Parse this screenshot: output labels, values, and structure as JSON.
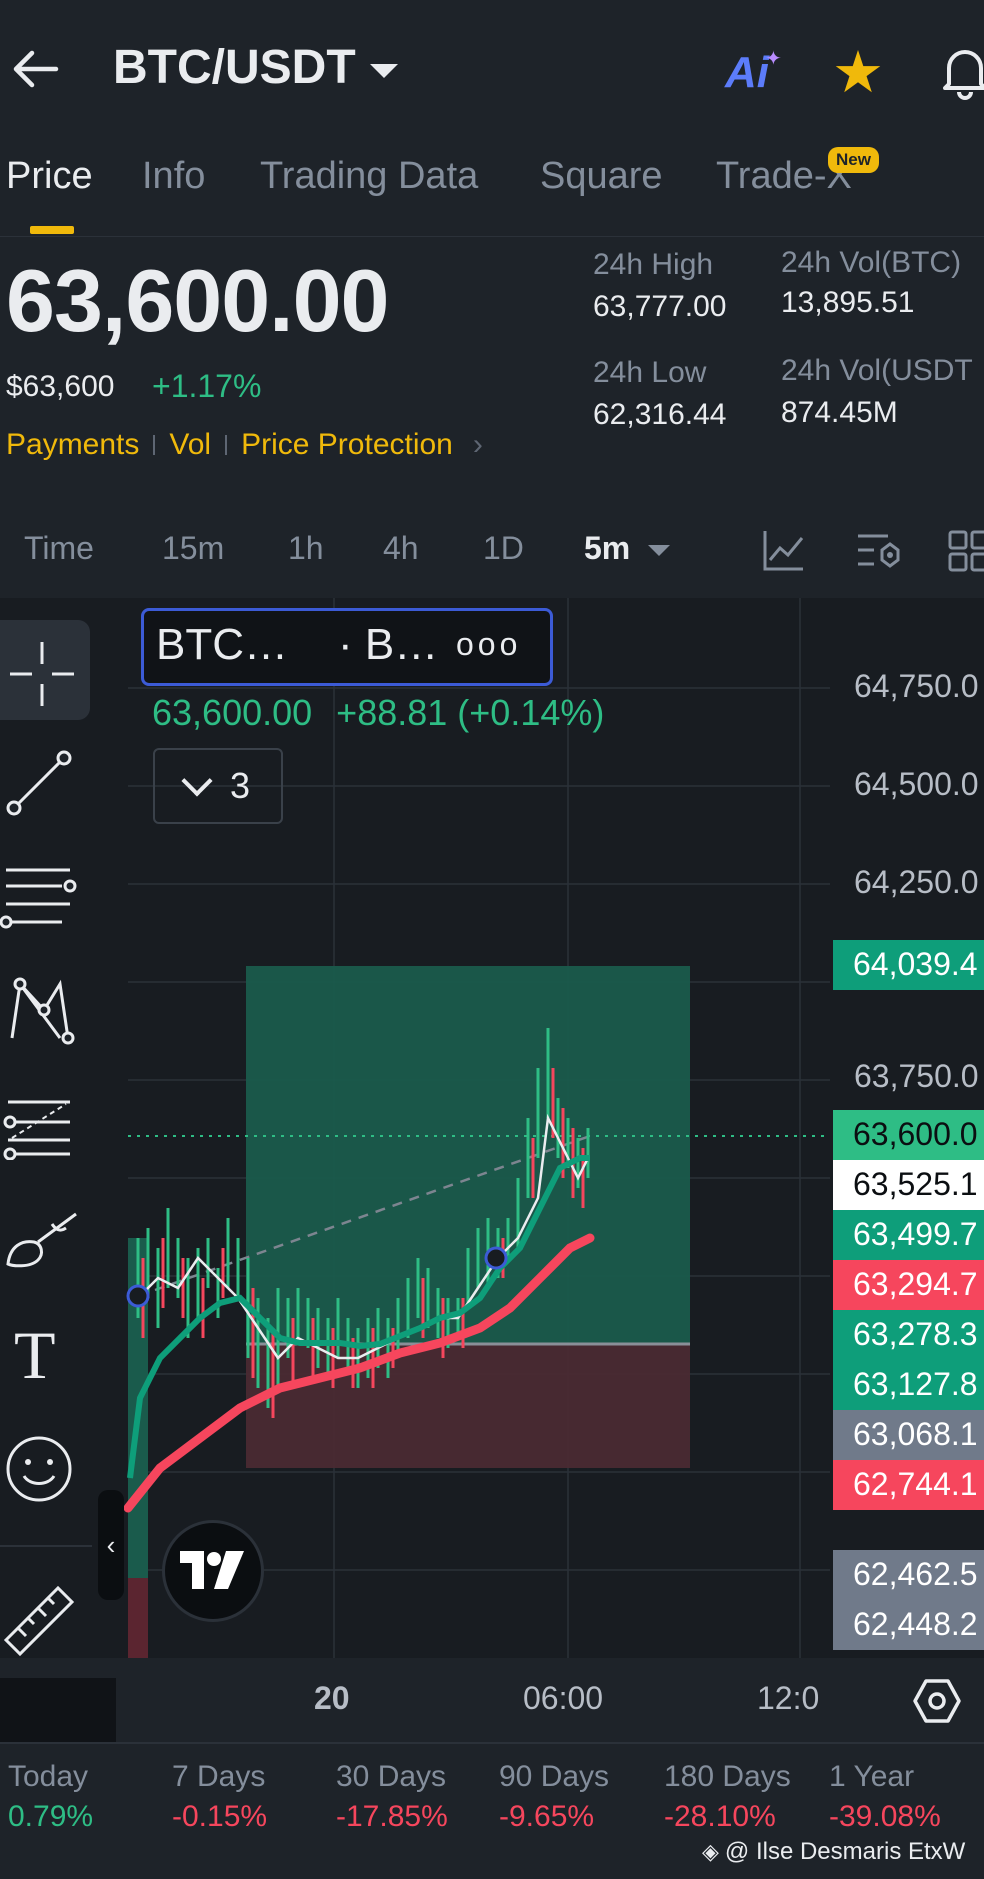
{
  "header": {
    "pair": "BTC/USDT",
    "ai_label": "Ai",
    "back_icon": "arrow-left-icon",
    "favorite_icon": "star-icon",
    "notify_icon": "bell-icon"
  },
  "tabs": [
    {
      "label": "Price",
      "active": true
    },
    {
      "label": "Info"
    },
    {
      "label": "Trading Data"
    },
    {
      "label": "Square"
    },
    {
      "label": "Trade-X",
      "badge": "New"
    }
  ],
  "ticker": {
    "price": "63,600.00",
    "usd_price": "$63,600",
    "change_pct": "+1.17%",
    "links": [
      "Payments",
      "Vol",
      "Price Protection"
    ],
    "high_label": "24h High",
    "high_value": "63,777.00",
    "vol_btc_label": "24h Vol(BTC)",
    "vol_btc_value": "13,895.51",
    "low_label": "24h Low",
    "low_value": "62,316.44",
    "vol_usdt_label": "24h Vol(USDT",
    "vol_usdt_value": "874.45M"
  },
  "timeframes": {
    "items": [
      "Time",
      "15m",
      "1h",
      "4h",
      "1D",
      "5m"
    ],
    "active": "5m"
  },
  "chart": {
    "legend_symbol": "BTC…",
    "legend_source": "· B…",
    "legend_more": "ooo",
    "legend_price": "63,600.00",
    "legend_change": "+88.81 (+0.14%)",
    "collapse_count": "3",
    "y_labels": [
      "64,750.0",
      "64,500.0",
      "64,250.0",
      "63,750.0"
    ],
    "x_labels": [
      "20",
      "06:00",
      "12:0"
    ],
    "price_tags": [
      {
        "text": "64,039.4",
        "color": "#0e9e7a",
        "text_color": "#ffffff"
      },
      {
        "text": "63,600.0",
        "color": "#2ebd85",
        "text_color": "#0b0e11"
      },
      {
        "text": "63,525.1",
        "color": "#ffffff",
        "text_color": "#0b0e11"
      },
      {
        "text": "63,499.7",
        "color": "#0e9e7a",
        "text_color": "#ffffff"
      },
      {
        "text": "63,294.7",
        "color": "#f6465d",
        "text_color": "#ffffff"
      },
      {
        "text": "63,278.3",
        "color": "#0e9e7a",
        "text_color": "#ffffff"
      },
      {
        "text": "63,127.8",
        "color": "#0e9e7a",
        "text_color": "#ffffff"
      },
      {
        "text": "63,068.1",
        "color": "#707a8a",
        "text_color": "#ffffff"
      },
      {
        "text": "62,744.1",
        "color": "#f6465d",
        "text_color": "#ffffff"
      },
      {
        "text": "62,462.5",
        "color": "#707a8a",
        "text_color": "#ffffff"
      },
      {
        "text": "62,448.2",
        "color": "#707a8a",
        "text_color": "#ffffff"
      }
    ]
  },
  "tools": [
    "crosshair-icon",
    "trend-line-icon",
    "horizontal-lines-icon",
    "pattern-icon",
    "fib-icon",
    "brush-icon",
    "text-icon",
    "emoji-icon",
    "ruler-icon"
  ],
  "performance": [
    {
      "label": "Today",
      "value": "0.79%",
      "color": "green"
    },
    {
      "label": "7 Days",
      "value": "-0.15%",
      "color": "red"
    },
    {
      "label": "30 Days",
      "value": "-17.85%",
      "color": "red"
    },
    {
      "label": "90 Days",
      "value": "-9.65%",
      "color": "red"
    },
    {
      "label": "180 Days",
      "value": "-28.10%",
      "color": "red"
    },
    {
      "label": "1 Year",
      "value": "-39.08%",
      "color": "red"
    }
  ],
  "watermark": "@ Ilse Desmaris EtxW"
}
